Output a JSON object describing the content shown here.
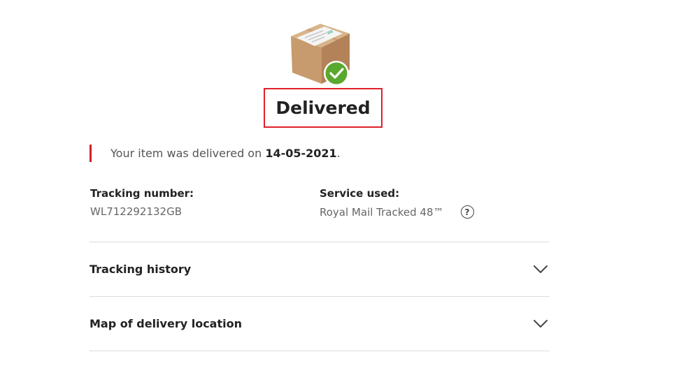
{
  "status": {
    "title": "Delivered",
    "icon": "parcel-delivered-icon",
    "check_color": "#5aa82e"
  },
  "message": {
    "prefix": "Your item was delivered on ",
    "date": "14-05-2021",
    "suffix": ".",
    "accent_color": "#d0202a"
  },
  "tracking": {
    "label": "Tracking number:",
    "value": "WL712292132GB"
  },
  "service": {
    "label": "Service used:",
    "value": "Royal Mail Tracked 48™",
    "help_icon": "?"
  },
  "accordions": [
    {
      "label": "Tracking history",
      "icon": "chevron-down-icon"
    },
    {
      "label": "Map of delivery location",
      "icon": "chevron-down-icon"
    }
  ]
}
